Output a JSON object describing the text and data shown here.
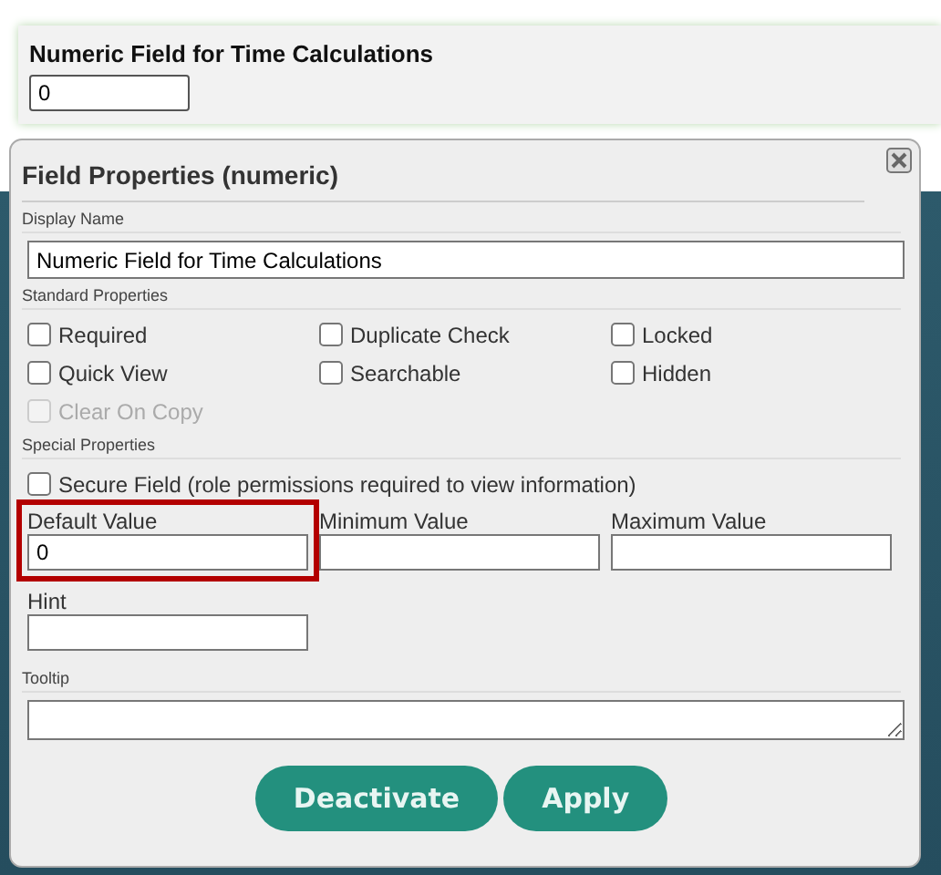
{
  "form_field": {
    "label": "Numeric Field for Time Calculations",
    "value": "0"
  },
  "dialog": {
    "title": "Field Properties (numeric)",
    "display_name": {
      "section": "Display Name",
      "value": "Numeric Field for Time Calculations"
    },
    "standard": {
      "section": "Standard Properties",
      "options": [
        {
          "label": "Required",
          "checked": false,
          "disabled": false
        },
        {
          "label": "Duplicate Check",
          "checked": false,
          "disabled": false
        },
        {
          "label": "Locked",
          "checked": false,
          "disabled": false
        },
        {
          "label": "Quick View",
          "checked": false,
          "disabled": false
        },
        {
          "label": "Searchable",
          "checked": false,
          "disabled": false
        },
        {
          "label": "Hidden",
          "checked": false,
          "disabled": false
        },
        {
          "label": "Clear On Copy",
          "checked": false,
          "disabled": true
        }
      ]
    },
    "special": {
      "section": "Special Properties",
      "secure": {
        "label": "Secure Field (role permissions required to view information)",
        "checked": false
      },
      "fields": [
        {
          "label": "Default Value",
          "value": "0",
          "highlighted": true
        },
        {
          "label": "Minimum Value",
          "highlighted": false
        },
        {
          "label": "Maximum Value",
          "highlighted": false
        },
        {
          "label": "Hint",
          "highlighted": false
        }
      ]
    },
    "tooltip": {
      "section": "Tooltip"
    },
    "buttons": [
      "Deactivate",
      "Apply"
    ]
  }
}
